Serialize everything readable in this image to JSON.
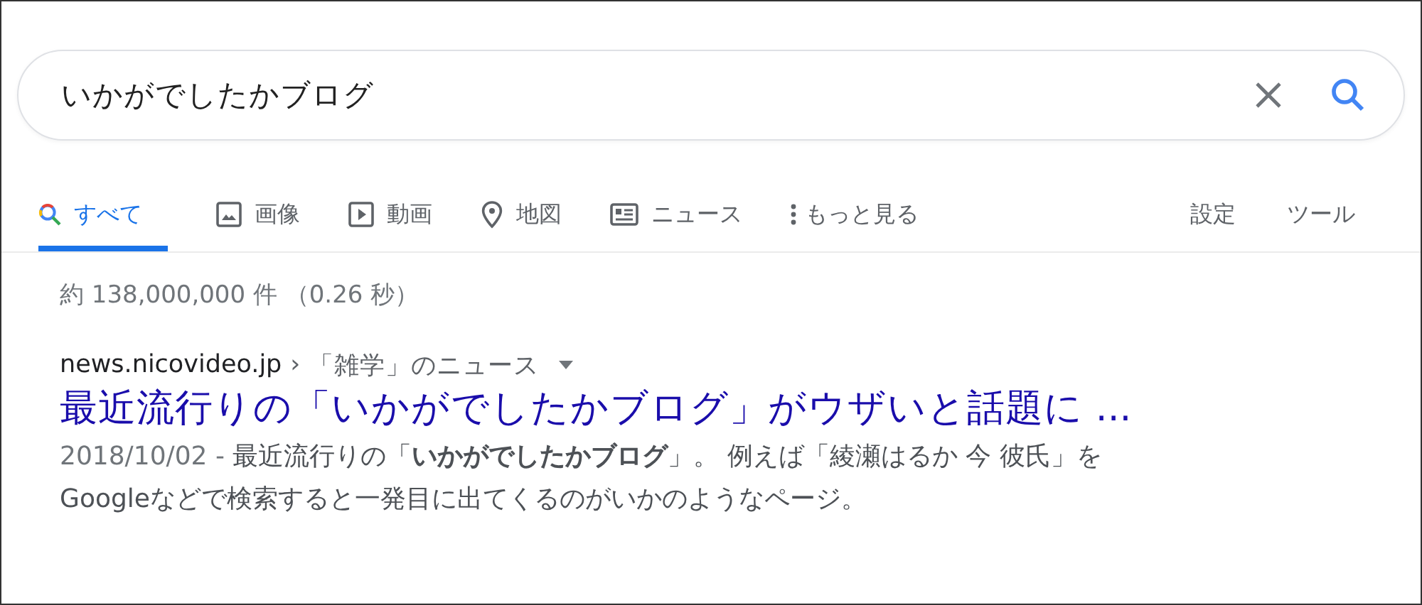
{
  "search": {
    "value": "いかがでしたかブログ"
  },
  "tabs": [
    {
      "label": "すべて",
      "selected": true
    },
    {
      "label": "画像",
      "selected": false
    },
    {
      "label": "動画",
      "selected": false
    },
    {
      "label": "地図",
      "selected": false
    },
    {
      "label": "ニュース",
      "selected": false
    },
    {
      "label": "もっと見る",
      "selected": false
    }
  ],
  "tools": [
    "設定",
    "ツール"
  ],
  "result_stats": "約 138,000,000 件 （0.26 秒）",
  "results": [
    {
      "url": "news.nicovideo.jp",
      "separator": "›",
      "breadcrumb": "「雑学」のニュース",
      "title": "最近流行りの「いかがでしたかブログ」がウザいと話題に ...",
      "date": "2018/10/02 - ",
      "snippet": "最近流行りの「**いかがでしたかブログ**」。 例えば「綾瀬はるか 今 彼氏」をGoogleなどで検索すると一発目に出てくるのがいかのようなページ。"
    }
  ]
}
